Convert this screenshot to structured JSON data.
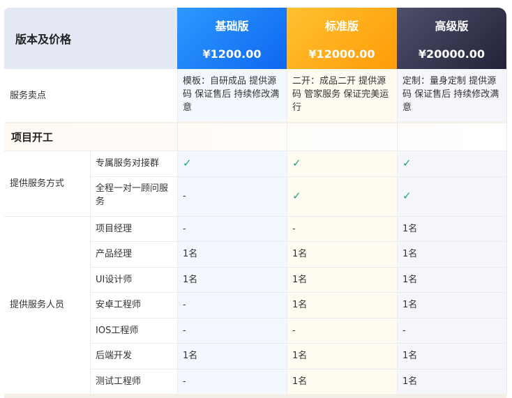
{
  "header": {
    "label": "版本及价格",
    "plans": [
      {
        "name": "基础版",
        "price": "¥1200.00"
      },
      {
        "name": "标准版",
        "price": "¥12000.00"
      },
      {
        "name": "高级版",
        "price": "¥20000.00"
      }
    ]
  },
  "selling": {
    "label": "服务卖点",
    "basic": "模板：自研成品 提供源码 保证售后 持续修改满意",
    "std": "二开：成品二开 提供源码 管家服务 保证完美运行",
    "adv": "定制：量身定制 提供源码 保证售后 持续修改满意"
  },
  "section": {
    "title": "项目开工"
  },
  "service_mode": {
    "group_label": "提供服务方式",
    "rows": [
      {
        "item": "专属服务对接群",
        "basic": "✓",
        "std": "✓",
        "adv": "✓"
      },
      {
        "item": "全程一对一顾问服务",
        "basic": "-",
        "std": "✓",
        "adv": "✓"
      }
    ]
  },
  "staff": {
    "group_label": "提供服务人员",
    "rows": [
      {
        "item": "项目经理",
        "basic": "-",
        "std": "-",
        "adv": "1名"
      },
      {
        "item": "产品经理",
        "basic": "1名",
        "std": "1名",
        "adv": "1名"
      },
      {
        "item": "UI设计师",
        "basic": "1名",
        "std": "1名",
        "adv": "1名"
      },
      {
        "item": "安卓工程师",
        "basic": "-",
        "std": "1名",
        "adv": "1名"
      },
      {
        "item": "IOS工程师",
        "basic": "-",
        "std": "-",
        "adv": "-"
      },
      {
        "item": "后端开发",
        "basic": "1名",
        "std": "1名",
        "adv": "1名"
      },
      {
        "item": "测试工程师",
        "basic": "-",
        "std": "1名",
        "adv": "1名"
      }
    ]
  }
}
